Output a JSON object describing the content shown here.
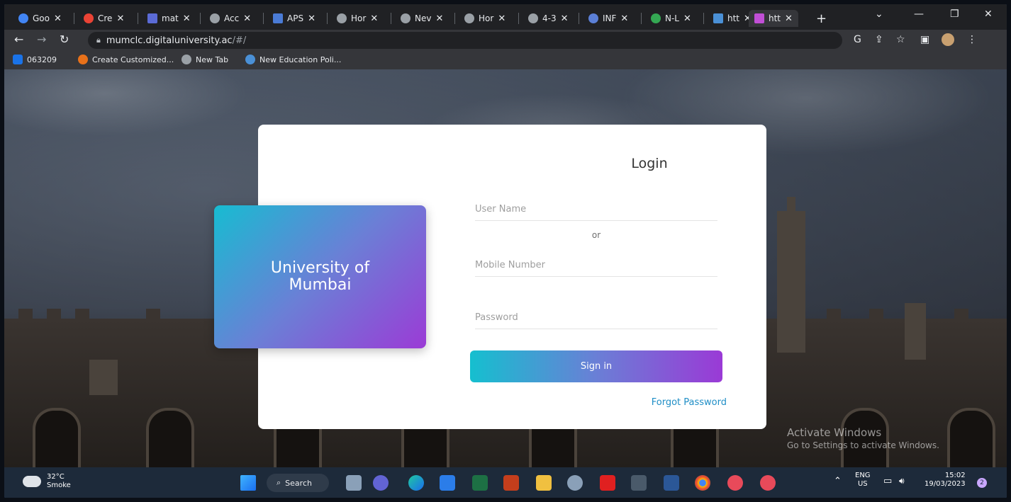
{
  "browser": {
    "tabs": [
      {
        "label": "Goo",
        "color": "#4285f4"
      },
      {
        "label": "Cre",
        "color": "#ea4335"
      },
      {
        "label": "mat",
        "color": "#5b6bd6"
      },
      {
        "label": "Acc",
        "color": "#9aa0a6"
      },
      {
        "label": "APS",
        "color": "#4a7bd6"
      },
      {
        "label": "Hor",
        "color": "#9aa0a6"
      },
      {
        "label": "Nev",
        "color": "#9aa0a6"
      },
      {
        "label": "Hor",
        "color": "#9aa0a6"
      },
      {
        "label": "4-3",
        "color": "#9aa0a6"
      },
      {
        "label": "INF",
        "color": "#5b7fd6"
      },
      {
        "label": "N-L",
        "color": "#34a853"
      },
      {
        "label": "htt",
        "color": "#4a90d6"
      },
      {
        "label": "htt",
        "color": "#c14fd6"
      }
    ],
    "close_glyph": "✕",
    "new_tab": "+",
    "url": {
      "host": "mumclc.digitaluniversity.ac",
      "path": "/#/"
    },
    "bookmarks": [
      {
        "label": "063209",
        "color": "#1a73e8"
      },
      {
        "label": "Create Customized...",
        "color": "#e8711a"
      },
      {
        "label": "New Tab",
        "color": "#9aa0a6"
      },
      {
        "label": "New Education Poli...",
        "color": "#4a90d6"
      }
    ]
  },
  "login": {
    "brand_line1": "University of",
    "brand_line2": "Mumbai",
    "title": "Login",
    "username_placeholder": "User Name",
    "or_text": "or",
    "mobile_placeholder": "Mobile Number",
    "password_placeholder": "Password",
    "signin_label": "Sign in",
    "forgot_label": "Forgot Password"
  },
  "watermark": {
    "title": "Activate Windows",
    "subtitle": "Go to Settings to activate Windows."
  },
  "taskbar": {
    "weather_temp": "32°C",
    "weather_desc": "Smoke",
    "search_label": "Search",
    "lang_top": "ENG",
    "lang_bottom": "US",
    "time": "15:02",
    "date": "19/03/2023",
    "notification_count": "2"
  }
}
